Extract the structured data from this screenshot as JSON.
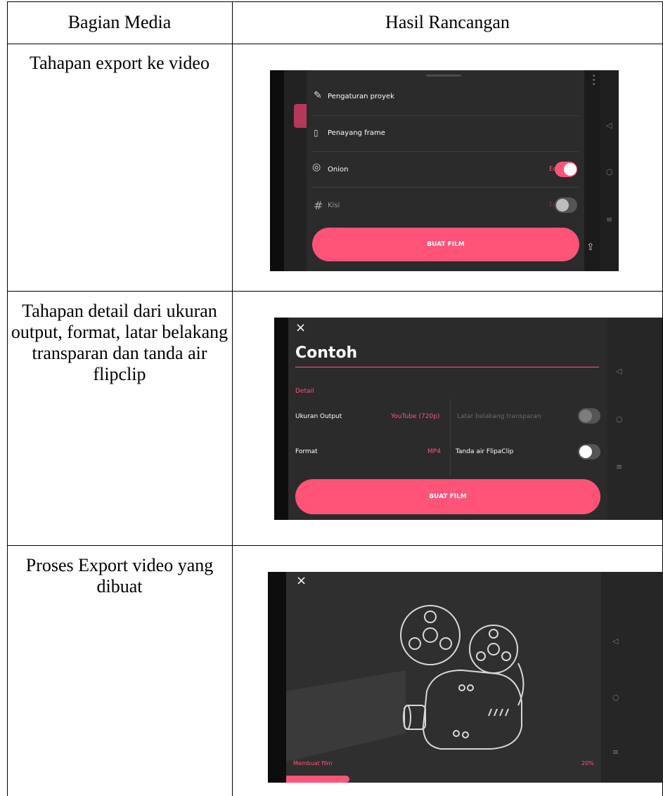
{
  "table": {
    "header_left": "Bagian Media",
    "header_right": "Hasil Rancangan",
    "rows": [
      {
        "label": "Tahapan export ke video"
      },
      {
        "label": "Tahapan detail dari ukuran output, format, latar belakang transparan dan tanda air flipclip"
      },
      {
        "label": "Proses Export video yang dibuat"
      }
    ]
  },
  "shot1": {
    "items": [
      {
        "label": "Pengaturan proyek",
        "icon": "pencil-icon"
      },
      {
        "label": "Penayang frame",
        "icon": "frame-viewer-icon"
      },
      {
        "label": "Onion",
        "icon": "onion-icon",
        "edit": "Edit",
        "toggle_on": true
      },
      {
        "label": "Kisi",
        "icon": "grid-hash-icon",
        "edit": "Edit",
        "toggle_on": false
      }
    ],
    "button": "BUAT FILM"
  },
  "shot2": {
    "close": "×",
    "title": "Contoh",
    "section": "Detail",
    "output_size_label": "Ukuran Output",
    "output_size_value": "YouTube (720p)",
    "transparent_bg_label": "Latar belakang transparan",
    "format_label": "Format",
    "format_value": "MP4",
    "watermark_label": "Tanda air FlipaClip",
    "button": "BUAT FILM"
  },
  "shot3": {
    "close": "×",
    "status": "Membuat film",
    "percent_text": "20%",
    "progress": 0.2
  },
  "colors": {
    "accent": "#ff5378",
    "panel": "#2b2b2b"
  }
}
